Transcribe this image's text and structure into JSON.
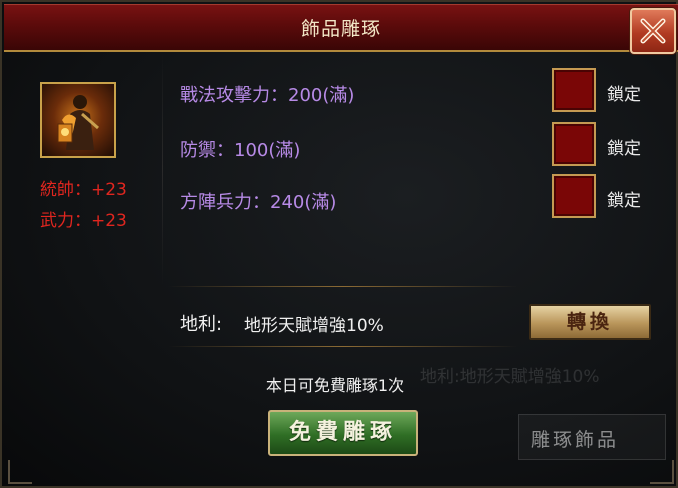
{
  "window": {
    "title": "飾品雕琢",
    "close_icon": "close-icon"
  },
  "hero": {
    "portrait_icon": "general-portrait-icon",
    "stats": [
      {
        "text": "統帥：+23"
      },
      {
        "text": "武力：+23"
      }
    ]
  },
  "attributes": [
    {
      "text": "戰法攻擊力：200(滿)",
      "lock_label": "鎖定"
    },
    {
      "text": "防禦：100(滿)",
      "lock_label": "鎖定"
    },
    {
      "text": "方陣兵力：240(滿)",
      "lock_label": "鎖定"
    }
  ],
  "terrain": {
    "label": "地利:",
    "value": "地形天賦增強10%",
    "convert_label": "轉換"
  },
  "free": {
    "note": "本日可免費雕琢1次",
    "button_label": "免費雕琢"
  },
  "background_ghost": {
    "terrain_text": "地利:地形天賦增強10%",
    "button_text": "雕琢飾品"
  },
  "colors": {
    "title_bar": "#6a0e0e",
    "stat_red": "#e0261f",
    "attribute_purple": "#b78ae6",
    "lock_box": "#7a0606",
    "free_button": "#2f6e25"
  }
}
